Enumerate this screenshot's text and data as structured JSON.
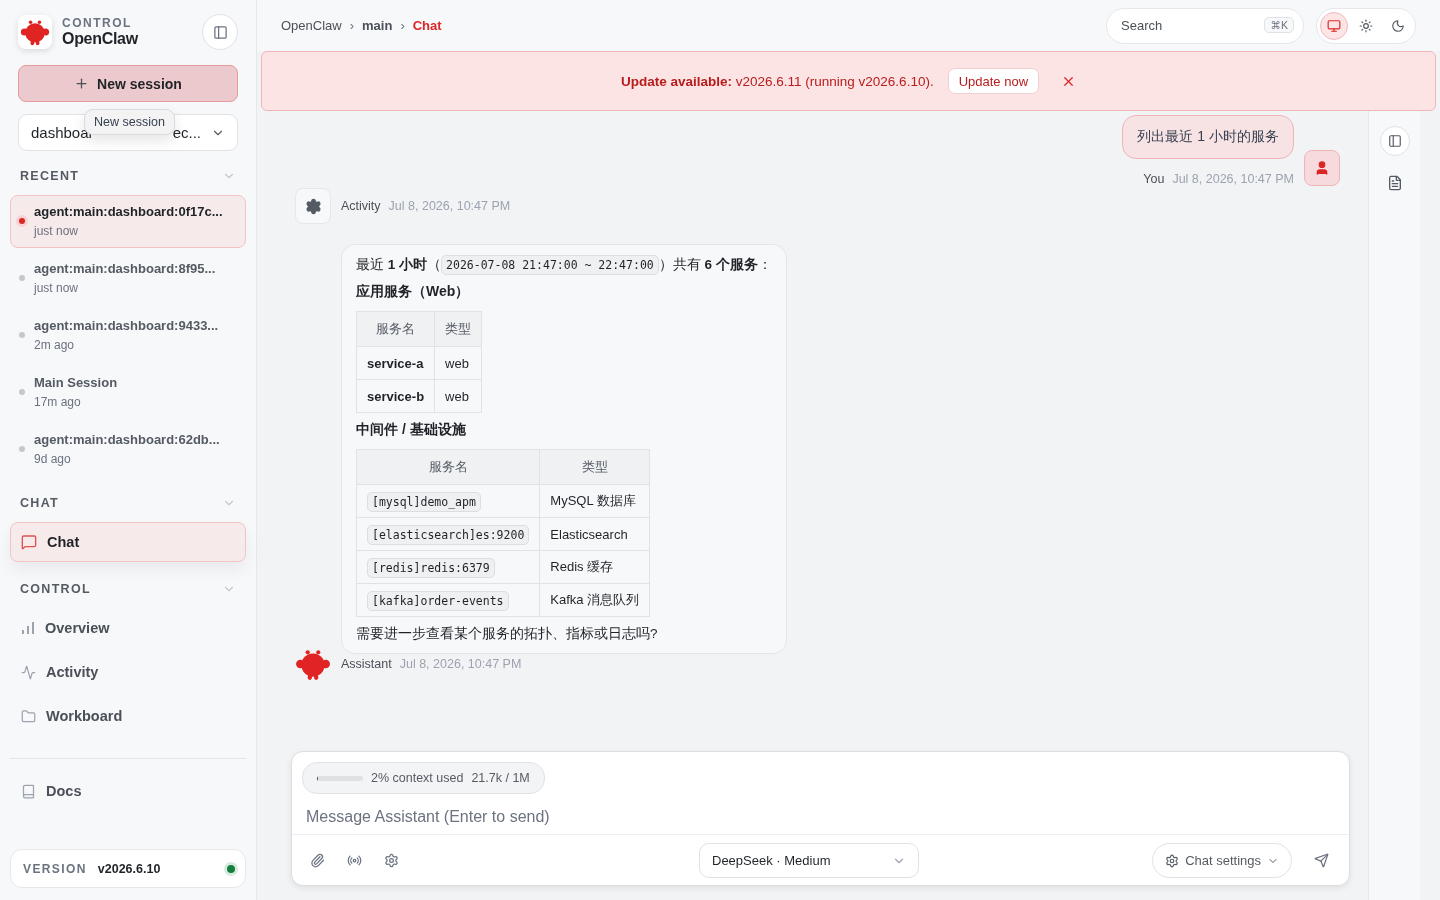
{
  "brand": {
    "eyebrow": "CONTROL",
    "name": "OpenClaw"
  },
  "new_session": {
    "label": "New session",
    "tooltip": "New session"
  },
  "session_select": {
    "value_start": "dashboar",
    "value_end": "ec..."
  },
  "recent": {
    "title": "RECENT",
    "items": [
      {
        "title": "agent:main:dashboard:0f17c...",
        "time": "just now",
        "selected": true
      },
      {
        "title": "agent:main:dashboard:8f95...",
        "time": "just now",
        "selected": false
      },
      {
        "title": "agent:main:dashboard:9433...",
        "time": "2m ago",
        "selected": false
      },
      {
        "title": "Main Session",
        "time": "17m ago",
        "selected": false
      },
      {
        "title": "agent:main:dashboard:62db...",
        "time": "9d ago",
        "selected": false
      }
    ]
  },
  "nav_sections": [
    {
      "title": "CHAT",
      "items": [
        {
          "label": "Chat",
          "selected": true
        }
      ]
    },
    {
      "title": "CONTROL",
      "items": [
        {
          "label": "Overview",
          "selected": false
        },
        {
          "label": "Activity",
          "selected": false
        },
        {
          "label": "Workboard",
          "selected": false
        }
      ]
    }
  ],
  "docs": {
    "label": "Docs"
  },
  "version": {
    "label": "VERSION",
    "value": "v2026.6.10"
  },
  "breadcrumb": [
    {
      "text": "OpenClaw",
      "kind": "plain"
    },
    {
      "text": "›",
      "kind": "sep"
    },
    {
      "text": "main",
      "kind": "strong"
    },
    {
      "text": "›",
      "kind": "sep"
    },
    {
      "text": "Chat",
      "kind": "current"
    }
  ],
  "search": {
    "placeholder": "Search",
    "shortcut": "⌘K"
  },
  "theme_modes": [
    {
      "selected": true
    },
    {
      "selected": false
    },
    {
      "selected": false
    }
  ],
  "banner": {
    "message": "**Update available:** v2026.6.11 (running v2026.6.10).",
    "action": "Update now"
  },
  "messages": [
    {
      "kind": "user",
      "text": "列出最近 1 小时的服务",
      "sender": "You",
      "time": "Jul 8, 2026, 10:47 PM"
    },
    {
      "kind": "activity",
      "sender": "Activity",
      "time": "Jul 8, 2026, 10:47 PM"
    },
    {
      "kind": "assistant",
      "sender": "Assistant",
      "time": "Jul 8, 2026, 10:47 PM",
      "blocks": [
        {
          "kind": "paragraph",
          "parts": [
            {
              "kind": "text",
              "text": "最近 **1 小时**（"
            },
            {
              "kind": "code",
              "text": "2026-07-08 21:47:00 ~ 22:47:00"
            },
            {
              "kind": "text",
              "text": "）共有 **6 个服务**："
            }
          ]
        },
        {
          "kind": "heading",
          "text": "应用服务（Web）"
        },
        {
          "kind": "table",
          "columns": [
            "服务名",
            "类型"
          ],
          "rows": [
            [
              {
                "kind": "strong",
                "text": "service-a"
              },
              {
                "kind": "text",
                "text": "web"
              }
            ],
            [
              {
                "kind": "strong",
                "text": "service-b"
              },
              {
                "kind": "text",
                "text": "web"
              }
            ]
          ]
        },
        {
          "kind": "heading",
          "text": "中间件 / 基础设施"
        },
        {
          "kind": "table",
          "columns": [
            "服务名",
            "类型"
          ],
          "rows": [
            [
              {
                "kind": "code",
                "text": "[mysql]demo_apm"
              },
              {
                "kind": "text",
                "text": "MySQL 数据库"
              }
            ],
            [
              {
                "kind": "code",
                "text": "[elasticsearch]es:9200"
              },
              {
                "kind": "text",
                "text": "Elasticsearch"
              }
            ],
            [
              {
                "kind": "code",
                "text": "[redis]redis:6379"
              },
              {
                "kind": "text",
                "text": "Redis 缓存"
              }
            ],
            [
              {
                "kind": "code",
                "text": "[kafka]order-events"
              },
              {
                "kind": "text",
                "text": "Kafka 消息队列"
              }
            ]
          ]
        },
        {
          "kind": "paragraph",
          "parts": [
            {
              "kind": "text",
              "text": "需要进一步查看某个服务的拓扑、指标或日志吗?"
            }
          ]
        }
      ]
    }
  ],
  "composer": {
    "context": {
      "level": 0.02,
      "label": "2% context used",
      "usage": "21.7k / 1M"
    },
    "placeholder": "Message Assistant (Enter to send)",
    "model": "DeepSeek · Medium",
    "settings": "Chat settings"
  }
}
